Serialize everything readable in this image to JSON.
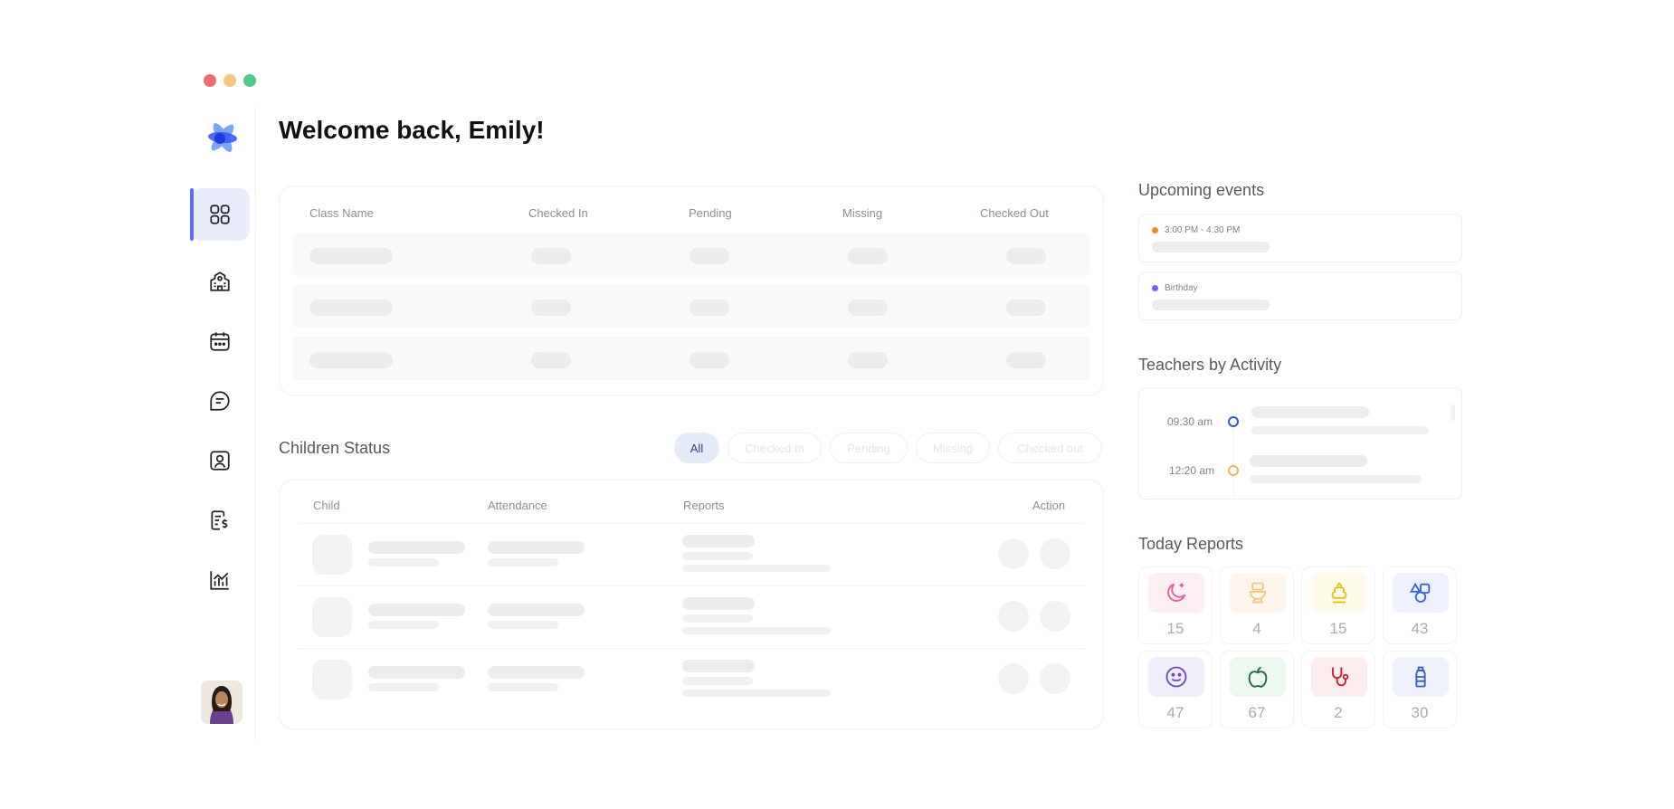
{
  "window": {
    "controls": [
      "close",
      "minimize",
      "maximize"
    ],
    "colors": {
      "close": "#f26b6b",
      "minimize": "#f8c77e",
      "maximize": "#4ecb8a"
    }
  },
  "brand": {
    "logo_icon": "petal-logo-icon",
    "colors": [
      "#3d5bf0",
      "#7aa6f5"
    ]
  },
  "sidebar": {
    "items": [
      {
        "icon": "dashboard-grid-icon",
        "active": true
      },
      {
        "icon": "school-building-icon",
        "active": false
      },
      {
        "icon": "calendar-icon",
        "active": false
      },
      {
        "icon": "chat-bubble-icon",
        "active": false
      },
      {
        "icon": "contact-card-icon",
        "active": false
      },
      {
        "icon": "billing-document-icon",
        "active": false
      },
      {
        "icon": "analytics-chart-icon",
        "active": false
      }
    ],
    "avatar": "user-avatar",
    "accent": "#5b6df0"
  },
  "header": {
    "title": "Welcome back, Emily!"
  },
  "class_table": {
    "columns": [
      "Class Name",
      "Checked In",
      "Pending",
      "Missing",
      "Checked Out"
    ],
    "loading_rows": 3
  },
  "children_status": {
    "title": "Children Status",
    "filters": [
      "All",
      "Checked In",
      "Pending",
      "Missing",
      "Checked out"
    ],
    "active_filter": "All",
    "columns": [
      "Child",
      "Attendance",
      "Reports",
      "Action"
    ],
    "loading_rows": 3
  },
  "upcoming_events": {
    "title": "Upcoming events",
    "items": [
      {
        "label": "3:00 PM - 4:30 PM",
        "color": "#f08a24"
      },
      {
        "label": "Birthday",
        "color": "#7a5cf0"
      }
    ]
  },
  "teachers_activity": {
    "title": "Teachers by Activity",
    "items": [
      {
        "time": "09:30 am",
        "color": "#3557c9"
      },
      {
        "time": "12:20 am",
        "color": "#f2b35c"
      }
    ]
  },
  "today_reports": {
    "title": "Today Reports",
    "items": [
      {
        "icon": "moon-sleep-icon",
        "count": "15",
        "color": "#e0609a",
        "bg": "#fdeef4"
      },
      {
        "icon": "toilet-icon",
        "count": "4",
        "color": "#f4c57a",
        "bg": "#fef6ec"
      },
      {
        "icon": "potty-icon",
        "count": "15",
        "color": "#e0c21a",
        "bg": "#fffbea"
      },
      {
        "icon": "shapes-activity-icon",
        "count": "43",
        "color": "#3a63d8",
        "bg": "#eef1fd"
      },
      {
        "icon": "smiley-mood-icon",
        "count": "47",
        "color": "#6a4ec8",
        "bg": "#f1eefb"
      },
      {
        "icon": "apple-meal-icon",
        "count": "67",
        "color": "#1f6b3a",
        "bg": "#ecf7ef"
      },
      {
        "icon": "stethoscope-health-icon",
        "count": "2",
        "color": "#c81e32",
        "bg": "#fdecee"
      },
      {
        "icon": "bottle-icon",
        "count": "30",
        "color": "#3a5bc4",
        "bg": "#eef1fb"
      }
    ]
  }
}
